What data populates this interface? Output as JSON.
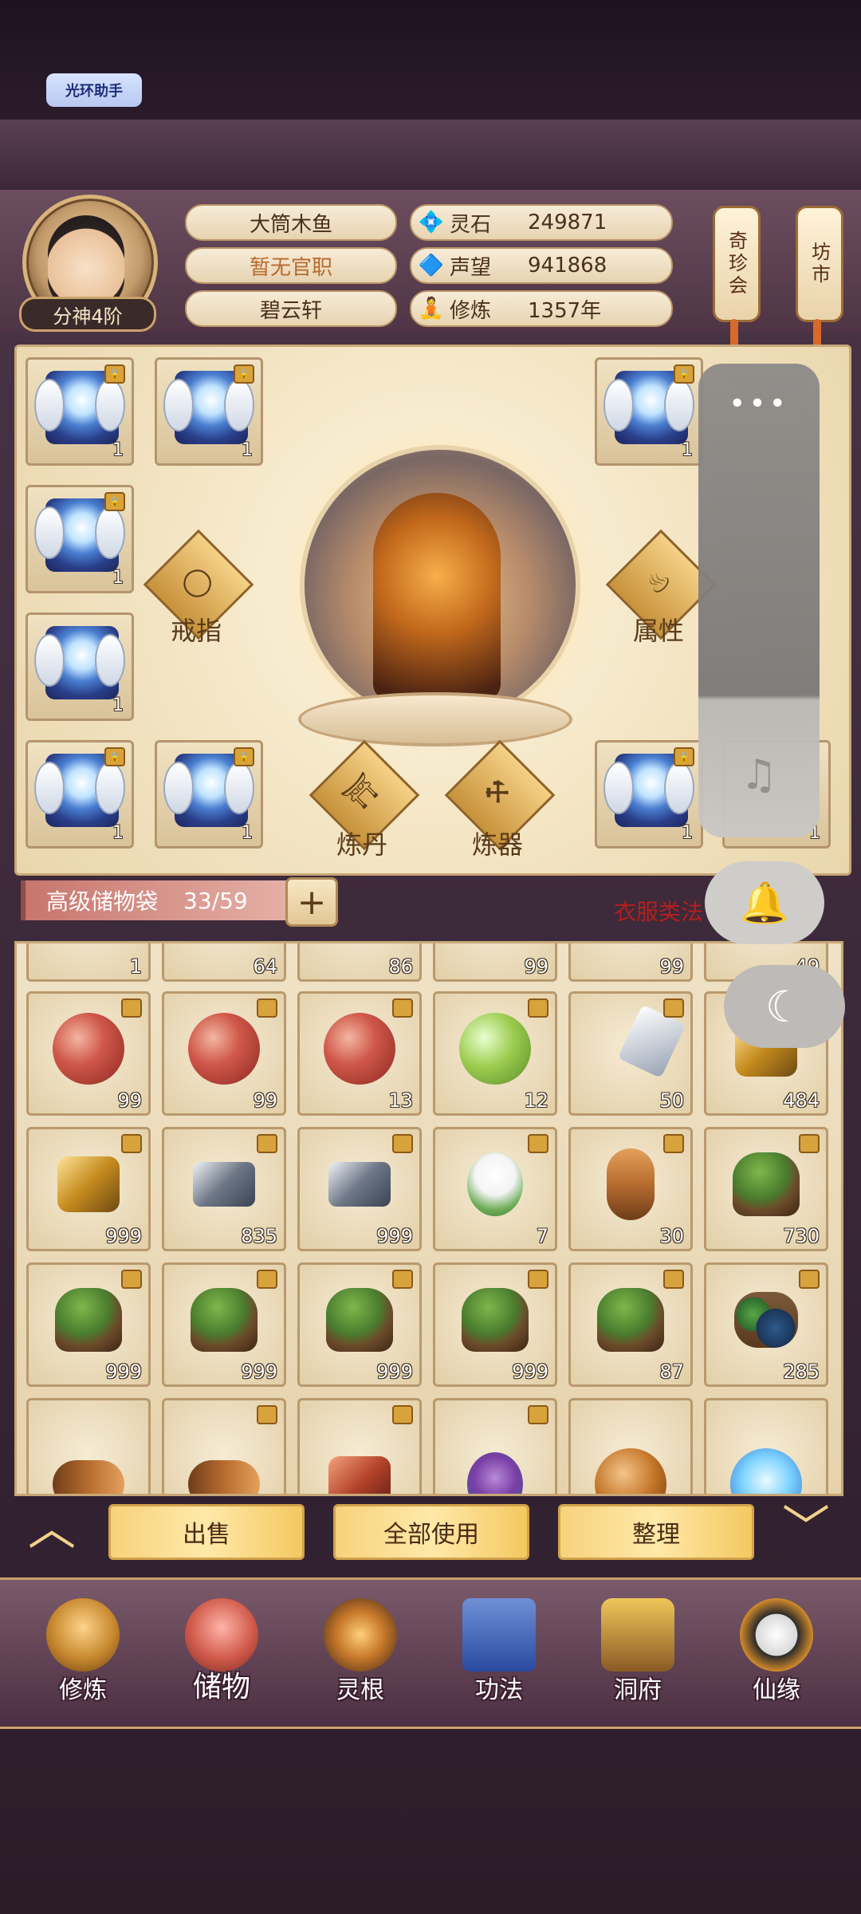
{
  "assistant_badge": "光环助手",
  "player": {
    "name": "大筒木鱼",
    "title": "暂无官职",
    "sect": "碧云轩",
    "rank": "分神4阶"
  },
  "stats": [
    {
      "label": "灵石",
      "value": "249871",
      "icon": "spirit-stone-icon"
    },
    {
      "label": "声望",
      "value": "941868",
      "icon": "reputation-icon"
    },
    {
      "label": "修炼",
      "value": "1357年",
      "icon": "cultivation-icon"
    }
  ],
  "shops": [
    "奇珍会",
    "坊市"
  ],
  "equipment": {
    "slots_left": [
      1,
      1,
      1,
      1
    ],
    "slots_top_mid": 1,
    "slot_bottom_mid": 1,
    "slot_top_right": 1,
    "slot_bottom_right": 1,
    "slot_bottom_far_right": 1
  },
  "skills": {
    "ring": "戒指",
    "attributes": "属性",
    "alchemy": "炼丹",
    "forging": "炼器"
  },
  "bag": {
    "label": "高级储物袋",
    "count": "33/59",
    "note": "衣服类法"
  },
  "inventory": {
    "partial_row": [
      "1",
      "64",
      "86",
      "99",
      "99",
      "49"
    ],
    "rows": [
      [
        {
          "type": "orb-red",
          "count": "99"
        },
        {
          "type": "orb-red",
          "count": "99"
        },
        {
          "type": "orb-red",
          "count": "13"
        },
        {
          "type": "orb-green",
          "count": "12"
        },
        {
          "type": "gem-white",
          "count": "50"
        },
        {
          "type": "gem-gold",
          "count": "484"
        }
      ],
      [
        {
          "type": "gem-gold",
          "count": "999"
        },
        {
          "type": "gem-silver",
          "count": "835"
        },
        {
          "type": "gem-silver",
          "count": "999"
        },
        {
          "type": "flower",
          "count": "7"
        },
        {
          "type": "root",
          "count": "30"
        },
        {
          "type": "herb",
          "count": "730"
        }
      ],
      [
        {
          "type": "herb",
          "count": "999"
        },
        {
          "type": "herb",
          "count": "999"
        },
        {
          "type": "herb",
          "count": "999"
        },
        {
          "type": "herb",
          "count": "999"
        },
        {
          "type": "herb",
          "count": "87"
        },
        {
          "type": "berry",
          "count": "285"
        }
      ]
    ]
  },
  "actions": [
    "出售",
    "全部使用",
    "整理"
  ],
  "nav": [
    "修炼",
    "储物",
    "灵根",
    "功法",
    "洞府",
    "仙缘"
  ]
}
